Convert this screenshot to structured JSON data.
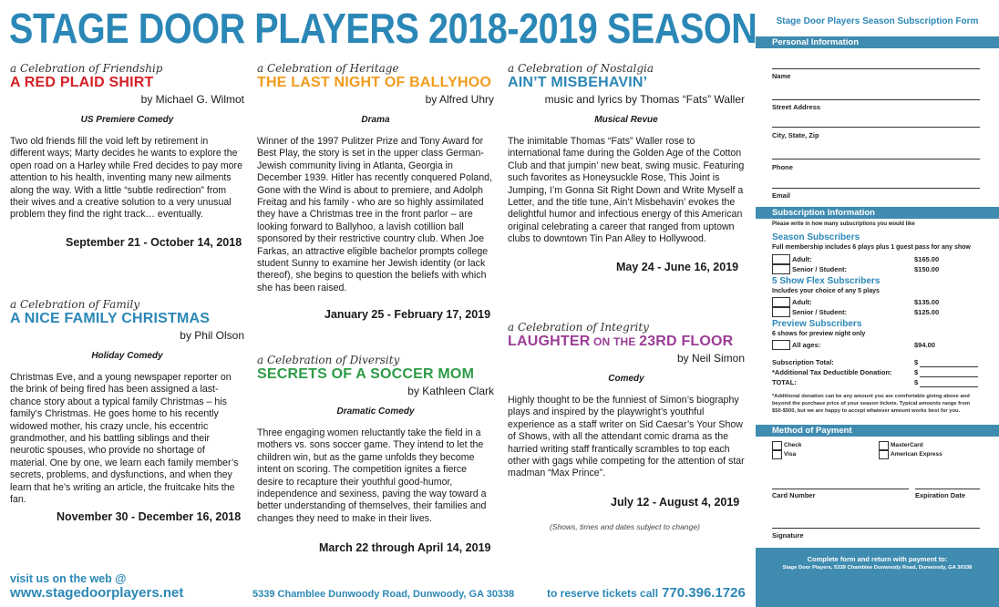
{
  "title": "STAGE DOOR PLAYERS 2018-2019 SEASON",
  "colors": {
    "accent": "#2b87b6",
    "red": "#d51f26",
    "orange": "#f29b1c",
    "blue": "#2b87b6",
    "green": "#2e9b47",
    "purple": "#9b3d96",
    "bar": "#3f8cb0"
  },
  "shows": [
    {
      "subtitle": "a Celebration of Friendship",
      "name_a": "A RED PLAID SHIRT",
      "name_b": "",
      "name_c": "",
      "author": "by Michael G. Wilmot",
      "genre": "US Premiere Comedy",
      "desc": "Two old friends fill the void left by retirement in different ways; Marty decides he wants to explore the open road on a Harley while Fred decides to pay more attention to his health, inventing many new ailments along the way. With a little “subtle redirection” from their wives and a creative solution to a very unusual problem they find the right track… eventually.",
      "dates": "September 21 - October 14, 2018"
    },
    {
      "subtitle": "a Celebration of Heritage",
      "name_a": "THE LAST NIGHT OF BALLYHOO",
      "name_b": "",
      "name_c": "",
      "author": "by Alfred Uhry",
      "genre": "Drama",
      "desc": "Winner of the 1997 Pulitzer Prize and Tony Award for Best Play, the story is set in the upper class German-Jewish community living in Atlanta, Georgia in December 1939. Hitler has recently conquered Poland, Gone with the Wind is about to premiere, and Adolph Freitag and his family - who are so highly assimilated they have a Christmas tree in the front parlor – are looking forward to Ballyhoo, a lavish cotillion ball sponsored by their restrictive country club. When Joe Farkas, an attractive eligible bachelor prompts college student Sunny to examine her Jewish identity (or lack thereof), she begins to question the beliefs with which she has been raised.",
      "dates": "January 25 - February 17, 2019"
    },
    {
      "subtitle": "a Celebration of Nostalgia",
      "name_a": "AIN’T MISBEHAVIN’",
      "name_b": "",
      "name_c": "",
      "author": "music and lyrics by Thomas “Fats” Waller",
      "genre": "Musical Revue",
      "desc": "The inimitable Thomas “Fats” Waller rose to international fame during the Golden Age of the Cotton Club and that jumpin’ new beat, swing music. Featuring such favorites as Honeysuckle Rose, This Joint is Jumping, I’m Gonna Sit Right Down and Write Myself a Letter, and the title tune, Ain’t Misbehavin’ evokes the delightful humor and infectious energy of this American original celebrating a career that ranged from uptown clubs to downtown Tin Pan Alley to Hollywood.",
      "dates": "May 24 - June 16, 2019"
    },
    {
      "subtitle": "a Celebration of Family",
      "name_a": "A NICE FAMILY CHRISTMAS",
      "name_b": "",
      "name_c": "",
      "author": "by Phil Olson",
      "genre": "Holiday Comedy",
      "desc": "Christmas Eve, and a young newspaper reporter on the brink of being fired has been assigned a last-chance story about a typical family Christmas – his family’s Christmas. He goes home to his recently widowed mother, his crazy uncle, his eccentric grandmother, and his battling siblings and their neurotic spouses, who provide no shortage of material. One by one, we learn each family member’s secrets, problems, and dysfunctions, and when they learn that he’s writing an article, the fruitcake hits the fan.",
      "dates": "November 30 - December 16, 2018"
    },
    {
      "subtitle": "a Celebration of Diversity",
      "name_a": "SECRETS OF A SOCCER MOM",
      "name_b": "",
      "name_c": "",
      "author": "by Kathleen Clark",
      "genre": "Dramatic Comedy",
      "desc": "Three engaging women reluctantly take the field in a mothers vs. sons soccer game. They intend to let the children win, but as the game unfolds they become intent on scoring. The competition ignites a fierce desire to recapture their youthful good-humor, independence and sexiness, paving the way toward a better understanding of themselves, their families and changes they need to make in their lives.",
      "dates": "March 22 through April 14, 2019"
    },
    {
      "subtitle": "a Celebration of Integrity",
      "name_a": "LAUGHTER",
      "name_b": " ON THE ",
      "name_c": "23RD FLOOR",
      "author": "by Neil Simon",
      "genre": "Comedy",
      "desc": "Highly thought to be the funniest of Simon’s biography plays and inspired by the playwright’s youthful experience as a staff writer on Sid Caesar’s Your Show of Shows, with all the attendant comic drama as the harried writing staff frantically scrambles to top each other with gags while competing for the attention of star madman “Max Prince”.",
      "dates": "July 12 - August 4, 2019"
    }
  ],
  "disclaimer": "(Shows, times and dates subject to change)",
  "footer": {
    "web_line1": "visit us on the web @",
    "web_line2": "www.stagedoorplayers.net",
    "address": "5339 Chamblee Dunwoody Road, Dunwoody, GA 30338",
    "tickets": "to reserve tickets call",
    "phone": "770.396.1726"
  },
  "form": {
    "title": "Stage Door Players Season Subscription Form",
    "personal_header": "Personal Information",
    "fields": [
      "Name",
      "Street Address",
      "City, State, Zip",
      "Phone",
      "Email"
    ],
    "subscription_header": "Subscription Information",
    "instruction": "Please write in how many subscriptions you would like",
    "season_title": "Season Subscribers",
    "season_desc": "Full membership includes 6 plays plus 1 guest pass for any show",
    "season_rows": [
      {
        "label": "Adult:",
        "price": "$165.00"
      },
      {
        "label": "Senior / Student:",
        "price": "$150.00"
      }
    ],
    "flex_title": "5 Show Flex Subscribers",
    "flex_desc": "Includes your choice of any 5 plays",
    "flex_rows": [
      {
        "label": "Adult:",
        "price": "$135.00"
      },
      {
        "label": "Senior / Student:",
        "price": "$125.00"
      }
    ],
    "preview_title": "Preview Subscribers",
    "preview_desc": "6 shows for preview night only",
    "preview_rows": [
      {
        "label": "All ages:",
        "price": "$94.00"
      }
    ],
    "totals": [
      "Subscription Total:",
      "*Additional Tax Deductible Donation:",
      "TOTAL:"
    ],
    "dollar": "$",
    "note": "*Additional donation can be any amount you are comfortable giving above and beyond the purchase price of your season tickets. Typical amounts range from $50-$500, but we are happy to accept whatever amount works best for you.",
    "payment_header": "Method of Payment",
    "payments": [
      "Check",
      "MasterCard",
      "Visa",
      "American Express"
    ],
    "card_number": "Card Number",
    "expiration": "Expiration Date",
    "signature": "Signature",
    "return_line1": "Complete form and return with payment to:",
    "return_line2": "Stage Door Players, 5339 Chamblee Dunwoody Road, Dunwoody, GA 30338"
  }
}
